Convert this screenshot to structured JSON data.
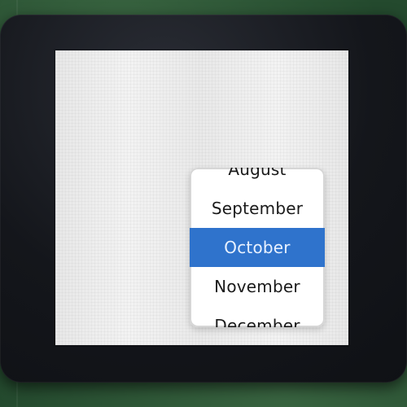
{
  "roller": {
    "items": [
      {
        "label": "August",
        "selected": false
      },
      {
        "label": "September",
        "selected": false
      },
      {
        "label": "October",
        "selected": true
      },
      {
        "label": "November",
        "selected": false
      },
      {
        "label": "December",
        "selected": false
      }
    ],
    "colors": {
      "selected_bg": "#2f73cc",
      "selected_text": "#e8f1ff",
      "text": "#1a1a1a",
      "panel_bg": "#ffffff",
      "panel_border": "#d6d6d6"
    }
  },
  "device": {
    "colors": {
      "pcb": "#244a2e",
      "bezel": "#14161b",
      "screen_bg": "#f2f2f2"
    }
  }
}
